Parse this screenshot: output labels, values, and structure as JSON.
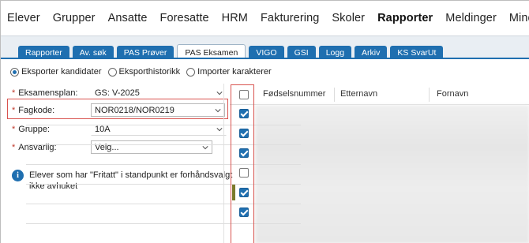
{
  "nav": {
    "items": [
      "Elever",
      "Grupper",
      "Ansatte",
      "Foresatte",
      "HRM",
      "Fakturering",
      "Skoler",
      "Rapporter",
      "Meldinger",
      "Mine dokumen"
    ],
    "active": "Rapporter"
  },
  "tabs": [
    "Rapporter",
    "Av. søk",
    "PAS Prøver",
    "PAS Eksamen",
    "VIGO",
    "GSI",
    "Logg",
    "Arkiv",
    "KS SvarUt"
  ],
  "active_tab": "PAS Eksamen",
  "radios": [
    {
      "label": "Eksporter kandidater",
      "checked": true
    },
    {
      "label": "Eksporthistorikk",
      "checked": false
    },
    {
      "label": "Importer karakterer",
      "checked": false
    }
  ],
  "form": {
    "eksamensplan": {
      "label": "Eksamensplan:",
      "value": "GS: V-2025"
    },
    "fagkode": {
      "label": "Fagkode:",
      "value": "NOR0218/NOR0219"
    },
    "gruppe": {
      "label": "Gruppe:",
      "value": "10A"
    },
    "ansvarlig": {
      "label": "Ansvarlig:",
      "value": "Velg..."
    }
  },
  "info_text_1": "Elever som har \"Fritatt\" i standpunkt er forhåndsvalgt",
  "info_text_2": "ikke avhuket",
  "grid": {
    "columns": [
      "Fødselsnummer",
      "Etternavn",
      "Fornavn"
    ],
    "row_checks": [
      true,
      true,
      true,
      false,
      true,
      true
    ]
  },
  "colors": {
    "accent": "#1f6fb0",
    "highlight": "#d9534f"
  }
}
